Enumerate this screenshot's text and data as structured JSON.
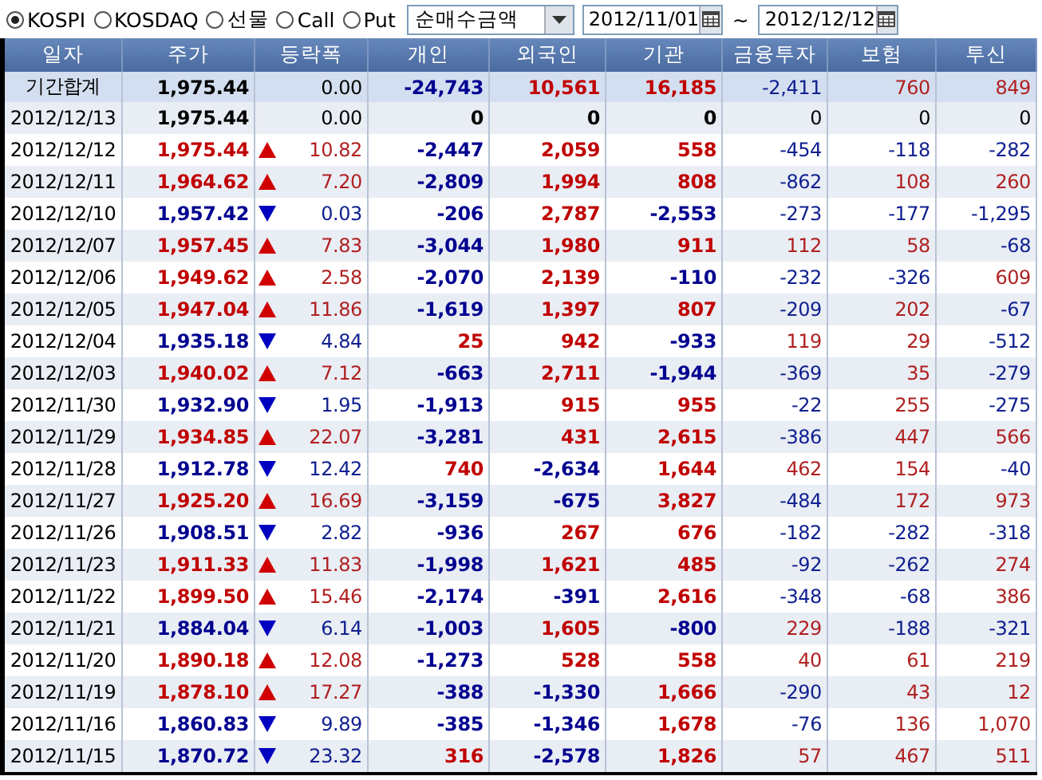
{
  "toolbar": {
    "markets": [
      {
        "label": "KOSPI",
        "selected": true
      },
      {
        "label": "KOSDAQ",
        "selected": false
      },
      {
        "label": "선물",
        "selected": false
      },
      {
        "label": "Call",
        "selected": false
      },
      {
        "label": "Put",
        "selected": false
      }
    ],
    "measure": "순매수금액",
    "date_from": "2012/11/01",
    "separator": "~",
    "date_to": "2012/12/12"
  },
  "table": {
    "columns": [
      "일자",
      "주가",
      "등락폭",
      "개인",
      "외국인",
      "기관",
      "금융투자",
      "보험",
      "투신"
    ],
    "summary": {
      "label": "기간합계",
      "price": {
        "text": "1,975.44",
        "color": "#000000"
      },
      "change": {
        "text": "0.00",
        "color": "#000000"
      },
      "investors": [
        {
          "text": "-24,743",
          "color": "#000090"
        },
        {
          "text": "10,561",
          "color": "#c00000"
        },
        {
          "text": "16,185",
          "color": "#c00000"
        },
        {
          "text": "-2,411",
          "color": "#102090"
        },
        {
          "text": "760",
          "color": "#b02020"
        },
        {
          "text": "849",
          "color": "#b02020"
        }
      ]
    },
    "rows": [
      {
        "kind": "flat",
        "date": "2012/12/13",
        "price": {
          "text": "1,975.44",
          "color": "#000000"
        },
        "change": {
          "text": "0.00",
          "color": "#000000"
        },
        "investors": [
          {
            "text": "0",
            "color": "#000000"
          },
          {
            "text": "0",
            "color": "#000000"
          },
          {
            "text": "0",
            "color": "#000000"
          },
          {
            "text": "0",
            "color": "#000000"
          },
          {
            "text": "0",
            "color": "#000000"
          },
          {
            "text": "0",
            "color": "#000000"
          }
        ]
      },
      {
        "kind": "rise",
        "date": "2012/12/12",
        "price": {
          "text": "1,975.44",
          "color": "#c00000"
        },
        "change": {
          "text": "10.82",
          "color": "#b02020"
        },
        "investors": [
          {
            "text": "-2,447",
            "color": "#000090"
          },
          {
            "text": "2,059",
            "color": "#c00000"
          },
          {
            "text": "558",
            "color": "#c00000"
          },
          {
            "text": "-454",
            "color": "#102090"
          },
          {
            "text": "-118",
            "color": "#102090"
          },
          {
            "text": "-282",
            "color": "#102090"
          }
        ]
      },
      {
        "kind": "rise",
        "date": "2012/12/11",
        "price": {
          "text": "1,964.62",
          "color": "#c00000"
        },
        "change": {
          "text": "7.20",
          "color": "#b02020"
        },
        "investors": [
          {
            "text": "-2,809",
            "color": "#000090"
          },
          {
            "text": "1,994",
            "color": "#c00000"
          },
          {
            "text": "808",
            "color": "#c00000"
          },
          {
            "text": "-862",
            "color": "#102090"
          },
          {
            "text": "108",
            "color": "#b02020"
          },
          {
            "text": "260",
            "color": "#b02020"
          }
        ]
      },
      {
        "kind": "fall",
        "date": "2012/12/10",
        "price": {
          "text": "1,957.42",
          "color": "#000090"
        },
        "change": {
          "text": "0.03",
          "color": "#102090"
        },
        "investors": [
          {
            "text": "-206",
            "color": "#000090"
          },
          {
            "text": "2,787",
            "color": "#c00000"
          },
          {
            "text": "-2,553",
            "color": "#000090"
          },
          {
            "text": "-273",
            "color": "#102090"
          },
          {
            "text": "-177",
            "color": "#102090"
          },
          {
            "text": "-1,295",
            "color": "#102090"
          }
        ]
      },
      {
        "kind": "rise",
        "date": "2012/12/07",
        "price": {
          "text": "1,957.45",
          "color": "#c00000"
        },
        "change": {
          "text": "7.83",
          "color": "#b02020"
        },
        "investors": [
          {
            "text": "-3,044",
            "color": "#000090"
          },
          {
            "text": "1,980",
            "color": "#c00000"
          },
          {
            "text": "911",
            "color": "#c00000"
          },
          {
            "text": "112",
            "color": "#b02020"
          },
          {
            "text": "58",
            "color": "#b02020"
          },
          {
            "text": "-68",
            "color": "#102090"
          }
        ]
      },
      {
        "kind": "rise",
        "date": "2012/12/06",
        "price": {
          "text": "1,949.62",
          "color": "#c00000"
        },
        "change": {
          "text": "2.58",
          "color": "#b02020"
        },
        "investors": [
          {
            "text": "-2,070",
            "color": "#000090"
          },
          {
            "text": "2,139",
            "color": "#c00000"
          },
          {
            "text": "-110",
            "color": "#000090"
          },
          {
            "text": "-232",
            "color": "#102090"
          },
          {
            "text": "-326",
            "color": "#102090"
          },
          {
            "text": "609",
            "color": "#b02020"
          }
        ]
      },
      {
        "kind": "rise",
        "date": "2012/12/05",
        "price": {
          "text": "1,947.04",
          "color": "#c00000"
        },
        "change": {
          "text": "11.86",
          "color": "#b02020"
        },
        "investors": [
          {
            "text": "-1,619",
            "color": "#000090"
          },
          {
            "text": "1,397",
            "color": "#c00000"
          },
          {
            "text": "807",
            "color": "#c00000"
          },
          {
            "text": "-209",
            "color": "#102090"
          },
          {
            "text": "202",
            "color": "#b02020"
          },
          {
            "text": "-67",
            "color": "#102090"
          }
        ]
      },
      {
        "kind": "fall",
        "date": "2012/12/04",
        "price": {
          "text": "1,935.18",
          "color": "#000090"
        },
        "change": {
          "text": "4.84",
          "color": "#102090"
        },
        "investors": [
          {
            "text": "25",
            "color": "#c00000"
          },
          {
            "text": "942",
            "color": "#c00000"
          },
          {
            "text": "-933",
            "color": "#000090"
          },
          {
            "text": "119",
            "color": "#b02020"
          },
          {
            "text": "29",
            "color": "#b02020"
          },
          {
            "text": "-512",
            "color": "#102090"
          }
        ]
      },
      {
        "kind": "rise",
        "date": "2012/12/03",
        "price": {
          "text": "1,940.02",
          "color": "#c00000"
        },
        "change": {
          "text": "7.12",
          "color": "#b02020"
        },
        "investors": [
          {
            "text": "-663",
            "color": "#000090"
          },
          {
            "text": "2,711",
            "color": "#c00000"
          },
          {
            "text": "-1,944",
            "color": "#000090"
          },
          {
            "text": "-369",
            "color": "#102090"
          },
          {
            "text": "35",
            "color": "#b02020"
          },
          {
            "text": "-279",
            "color": "#102090"
          }
        ]
      },
      {
        "kind": "fall",
        "date": "2012/11/30",
        "price": {
          "text": "1,932.90",
          "color": "#000090"
        },
        "change": {
          "text": "1.95",
          "color": "#102090"
        },
        "investors": [
          {
            "text": "-1,913",
            "color": "#000090"
          },
          {
            "text": "915",
            "color": "#c00000"
          },
          {
            "text": "955",
            "color": "#c00000"
          },
          {
            "text": "-22",
            "color": "#102090"
          },
          {
            "text": "255",
            "color": "#b02020"
          },
          {
            "text": "-275",
            "color": "#102090"
          }
        ]
      },
      {
        "kind": "rise",
        "date": "2012/11/29",
        "price": {
          "text": "1,934.85",
          "color": "#c00000"
        },
        "change": {
          "text": "22.07",
          "color": "#b02020"
        },
        "investors": [
          {
            "text": "-3,281",
            "color": "#000090"
          },
          {
            "text": "431",
            "color": "#c00000"
          },
          {
            "text": "2,615",
            "color": "#c00000"
          },
          {
            "text": "-386",
            "color": "#102090"
          },
          {
            "text": "447",
            "color": "#b02020"
          },
          {
            "text": "566",
            "color": "#b02020"
          }
        ]
      },
      {
        "kind": "fall",
        "date": "2012/11/28",
        "price": {
          "text": "1,912.78",
          "color": "#000090"
        },
        "change": {
          "text": "12.42",
          "color": "#102090"
        },
        "investors": [
          {
            "text": "740",
            "color": "#c00000"
          },
          {
            "text": "-2,634",
            "color": "#000090"
          },
          {
            "text": "1,644",
            "color": "#c00000"
          },
          {
            "text": "462",
            "color": "#b02020"
          },
          {
            "text": "154",
            "color": "#b02020"
          },
          {
            "text": "-40",
            "color": "#102090"
          }
        ]
      },
      {
        "kind": "rise",
        "date": "2012/11/27",
        "price": {
          "text": "1,925.20",
          "color": "#c00000"
        },
        "change": {
          "text": "16.69",
          "color": "#b02020"
        },
        "investors": [
          {
            "text": "-3,159",
            "color": "#000090"
          },
          {
            "text": "-675",
            "color": "#000090"
          },
          {
            "text": "3,827",
            "color": "#c00000"
          },
          {
            "text": "-484",
            "color": "#102090"
          },
          {
            "text": "172",
            "color": "#b02020"
          },
          {
            "text": "973",
            "color": "#b02020"
          }
        ]
      },
      {
        "kind": "fall",
        "date": "2012/11/26",
        "price": {
          "text": "1,908.51",
          "color": "#000090"
        },
        "change": {
          "text": "2.82",
          "color": "#102090"
        },
        "investors": [
          {
            "text": "-936",
            "color": "#000090"
          },
          {
            "text": "267",
            "color": "#c00000"
          },
          {
            "text": "676",
            "color": "#c00000"
          },
          {
            "text": "-182",
            "color": "#102090"
          },
          {
            "text": "-282",
            "color": "#102090"
          },
          {
            "text": "-318",
            "color": "#102090"
          }
        ]
      },
      {
        "kind": "rise",
        "date": "2012/11/23",
        "price": {
          "text": "1,911.33",
          "color": "#c00000"
        },
        "change": {
          "text": "11.83",
          "color": "#b02020"
        },
        "investors": [
          {
            "text": "-1,998",
            "color": "#000090"
          },
          {
            "text": "1,621",
            "color": "#c00000"
          },
          {
            "text": "485",
            "color": "#c00000"
          },
          {
            "text": "-92",
            "color": "#102090"
          },
          {
            "text": "-262",
            "color": "#102090"
          },
          {
            "text": "274",
            "color": "#b02020"
          }
        ]
      },
      {
        "kind": "rise",
        "date": "2012/11/22",
        "price": {
          "text": "1,899.50",
          "color": "#c00000"
        },
        "change": {
          "text": "15.46",
          "color": "#b02020"
        },
        "investors": [
          {
            "text": "-2,174",
            "color": "#000090"
          },
          {
            "text": "-391",
            "color": "#000090"
          },
          {
            "text": "2,616",
            "color": "#c00000"
          },
          {
            "text": "-348",
            "color": "#102090"
          },
          {
            "text": "-68",
            "color": "#102090"
          },
          {
            "text": "386",
            "color": "#b02020"
          }
        ]
      },
      {
        "kind": "fall",
        "date": "2012/11/21",
        "price": {
          "text": "1,884.04",
          "color": "#000090"
        },
        "change": {
          "text": "6.14",
          "color": "#102090"
        },
        "investors": [
          {
            "text": "-1,003",
            "color": "#000090"
          },
          {
            "text": "1,605",
            "color": "#c00000"
          },
          {
            "text": "-800",
            "color": "#000090"
          },
          {
            "text": "229",
            "color": "#b02020"
          },
          {
            "text": "-188",
            "color": "#102090"
          },
          {
            "text": "-321",
            "color": "#102090"
          }
        ]
      },
      {
        "kind": "rise",
        "date": "2012/11/20",
        "price": {
          "text": "1,890.18",
          "color": "#c00000"
        },
        "change": {
          "text": "12.08",
          "color": "#b02020"
        },
        "investors": [
          {
            "text": "-1,273",
            "color": "#000090"
          },
          {
            "text": "528",
            "color": "#c00000"
          },
          {
            "text": "558",
            "color": "#c00000"
          },
          {
            "text": "40",
            "color": "#b02020"
          },
          {
            "text": "61",
            "color": "#b02020"
          },
          {
            "text": "219",
            "color": "#b02020"
          }
        ]
      },
      {
        "kind": "rise",
        "date": "2012/11/19",
        "price": {
          "text": "1,878.10",
          "color": "#c00000"
        },
        "change": {
          "text": "17.27",
          "color": "#b02020"
        },
        "investors": [
          {
            "text": "-388",
            "color": "#000090"
          },
          {
            "text": "-1,330",
            "color": "#000090"
          },
          {
            "text": "1,666",
            "color": "#c00000"
          },
          {
            "text": "-290",
            "color": "#102090"
          },
          {
            "text": "43",
            "color": "#b02020"
          },
          {
            "text": "12",
            "color": "#b02020"
          }
        ]
      },
      {
        "kind": "fall",
        "date": "2012/11/16",
        "price": {
          "text": "1,860.83",
          "color": "#000090"
        },
        "change": {
          "text": "9.89",
          "color": "#102090"
        },
        "investors": [
          {
            "text": "-385",
            "color": "#000090"
          },
          {
            "text": "-1,346",
            "color": "#000090"
          },
          {
            "text": "1,678",
            "color": "#c00000"
          },
          {
            "text": "-76",
            "color": "#102090"
          },
          {
            "text": "136",
            "color": "#b02020"
          },
          {
            "text": "1,070",
            "color": "#b02020"
          }
        ]
      },
      {
        "kind": "fall",
        "date": "2012/11/15",
        "price": {
          "text": "1,870.72",
          "color": "#000090"
        },
        "change": {
          "text": "23.32",
          "color": "#102090"
        },
        "investors": [
          {
            "text": "316",
            "color": "#c00000"
          },
          {
            "text": "-2,578",
            "color": "#000090"
          },
          {
            "text": "1,826",
            "color": "#c00000"
          },
          {
            "text": "57",
            "color": "#b02020"
          },
          {
            "text": "467",
            "color": "#b02020"
          },
          {
            "text": "511",
            "color": "#b02020"
          }
        ]
      }
    ]
  }
}
